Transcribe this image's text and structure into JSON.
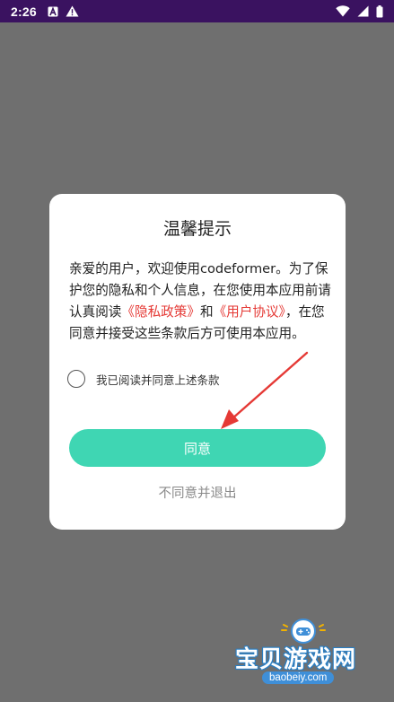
{
  "status_bar": {
    "time": "2:26",
    "left_icons": [
      "a-letter-icon",
      "warning-icon"
    ],
    "right_icons": [
      "wifi-icon",
      "signal-icon",
      "battery-icon"
    ]
  },
  "dialog": {
    "title": "温馨提示",
    "message": {
      "line_1": "亲爱的用户，欢迎使用codeformer。为了保护您的隐私和个人信息，在您使用本应用前请认真阅读",
      "privacy_link": "《隐私政策》",
      "and": "和",
      "terms_link": "《用户协议》",
      "tail": "，在您同意并接受这些条款后方可使用本应用。"
    },
    "agree_checkbox_label": "我已阅读并同意上述条款",
    "agree_button": "同意",
    "decline_link": "不同意并退出"
  },
  "watermark": {
    "text": "宝贝游戏网",
    "url": "baobeiy.com"
  },
  "colors": {
    "status_bar_bg": "#3a1260",
    "overlay_bg": "#6f6f6f",
    "accent_button": "#3fd6b3",
    "link": "#e53935",
    "annotation_arrow": "#e53935"
  }
}
